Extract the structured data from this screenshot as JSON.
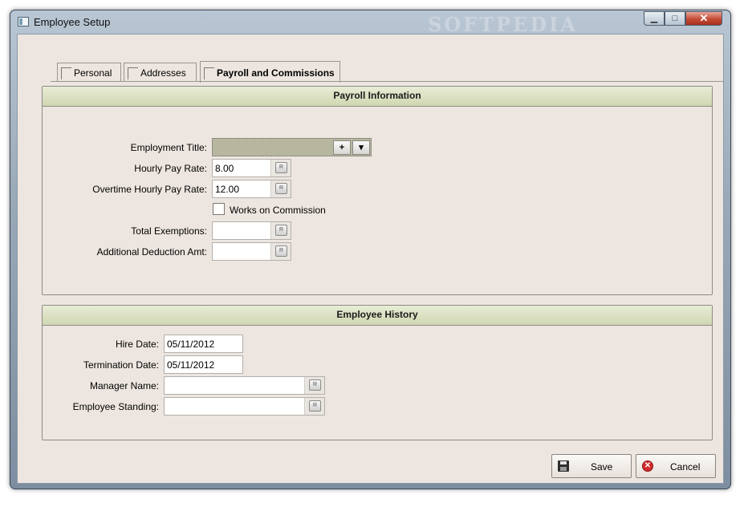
{
  "window": {
    "title": "Employee Setup",
    "watermark": "SOFTPEDIA",
    "controls": {
      "minimize": "▁",
      "maximize": "□",
      "close": "✕"
    }
  },
  "tabs": [
    {
      "label": "Personal"
    },
    {
      "label": "Addresses"
    },
    {
      "label": "Payroll and Commissions",
      "active": true
    }
  ],
  "payroll": {
    "header": "Payroll Information",
    "employment_title_label": "Employment Title:",
    "add_label": "+",
    "dropdown_label": "▾",
    "hourly_label": "Hourly Pay Rate:",
    "hourly_value": "8.00",
    "overtime_label": "Overtime Hourly Pay Rate:",
    "overtime_value": "12.00",
    "commission_label": "Works on Commission",
    "exemptions_label": "Total Exemptions:",
    "exemptions_value": "",
    "deduction_label": "Additional Deduction Amt:",
    "deduction_value": ""
  },
  "history": {
    "header": "Employee History",
    "hire_label": "Hire Date:",
    "hire_value": "05/11/2012",
    "termination_label": "Termination Date:",
    "termination_value": "05/11/2012",
    "manager_label": "Manager Name:",
    "manager_value": "",
    "standing_label": "Employee Standing:",
    "standing_value": ""
  },
  "field_button_glyph": "R",
  "buttons": {
    "save": "Save",
    "cancel": "Cancel"
  },
  "icons": {
    "save": "floppy-disk-icon",
    "cancel": "red-x-circle-icon"
  }
}
